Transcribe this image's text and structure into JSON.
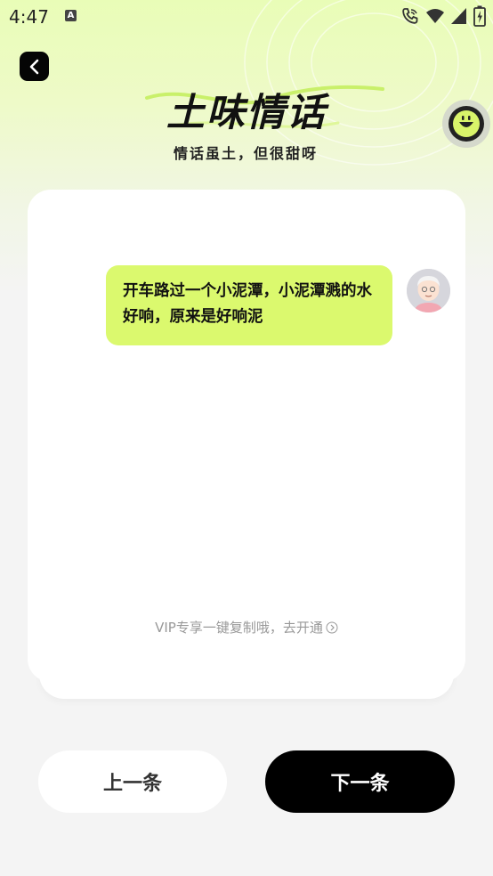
{
  "status_bar": {
    "time": "4:47",
    "notification_icon": "a-icon",
    "icons": [
      "wifi-call-icon",
      "wifi-icon",
      "signal-icon",
      "battery-icon"
    ]
  },
  "header": {
    "back_icon": "chevron-left-icon",
    "title": "土味情话",
    "subtitle": "情话虽土，但很甜呀",
    "mascot_icon": "smiley-mascot-icon"
  },
  "message": {
    "text": "开车路过一个小泥潭，小泥潭溅的水好响，原来是好响泥",
    "avatar": "elderly-woman-avatar"
  },
  "vip_hint": {
    "text": "VIP专享一键复制哦，去开通",
    "icon": "circle-chevron-right-icon"
  },
  "buttons": {
    "prev_label": "上一条",
    "next_label": "下一条"
  },
  "colors": {
    "accent": "#dbf96e",
    "primary_button": "#000000",
    "background": "#f4f4f4"
  }
}
